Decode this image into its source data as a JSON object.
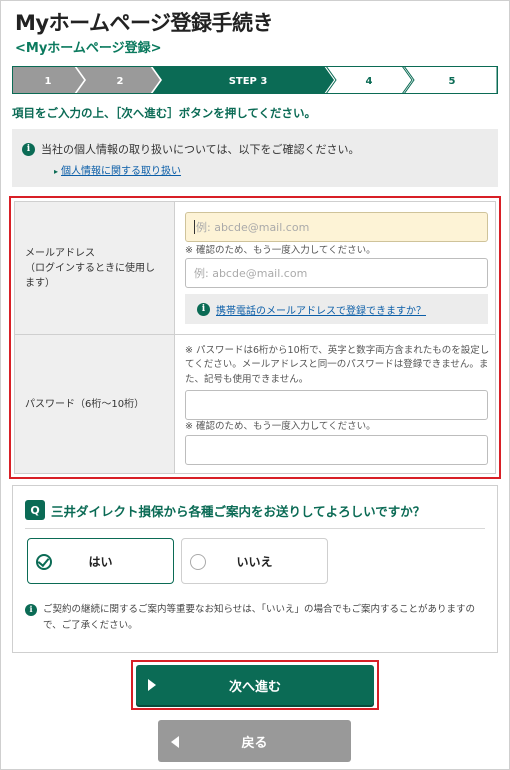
{
  "header": {
    "title": "Myホームページ登録手続き",
    "subtitle": "<Myホームページ登録>"
  },
  "steps": [
    {
      "label": "1",
      "state": "done"
    },
    {
      "label": "2",
      "state": "done"
    },
    {
      "label": "STEP 3",
      "state": "current"
    },
    {
      "label": "4",
      "state": "todo"
    },
    {
      "label": "5",
      "state": "todo"
    }
  ],
  "colors": {
    "accent": "#0b6b55",
    "done": "#9a9a9a",
    "highlight": "#d81f26"
  },
  "instruction": "項目をご入力の上、［次へ進む］ボタンを押してください。",
  "notice": {
    "text": "当社の個人情報の取り扱いについては、以下をご確認ください。",
    "link": "個人情報に関する取り扱い"
  },
  "email": {
    "label": "メールアドレス\n（ログインするときに使用します）",
    "placeholder": "例: abcde@mail.com",
    "confirm_note": "※ 確認のため、もう一度入力してください。",
    "confirm_placeholder": "例: abcde@mail.com",
    "mobile_link": "携帯電話のメールアドレスで登録できますか？"
  },
  "password": {
    "label": "パスワード（6桁〜10桁）",
    "rule_note": "※ パスワードは6桁から10桁で、英字と数字両方含まれたものを設定してください。メールアドレスと同一のパスワードは登録できません。また、記号も使用できません。",
    "confirm_note": "※ 確認のため、もう一度入力してください。"
  },
  "question": {
    "badge": "Q",
    "text": "三井ダイレクト損保から各種ご案内をお送りしてよろしいですか？",
    "yes": "はい",
    "no": "いいえ",
    "selected": "yes",
    "note": "ご契約の継続に関するご案内等重要なお知らせは、「いいえ」の場合でもご案内することがありますので、ご了承ください。"
  },
  "buttons": {
    "next": "次へ進む",
    "back": "戻る"
  }
}
